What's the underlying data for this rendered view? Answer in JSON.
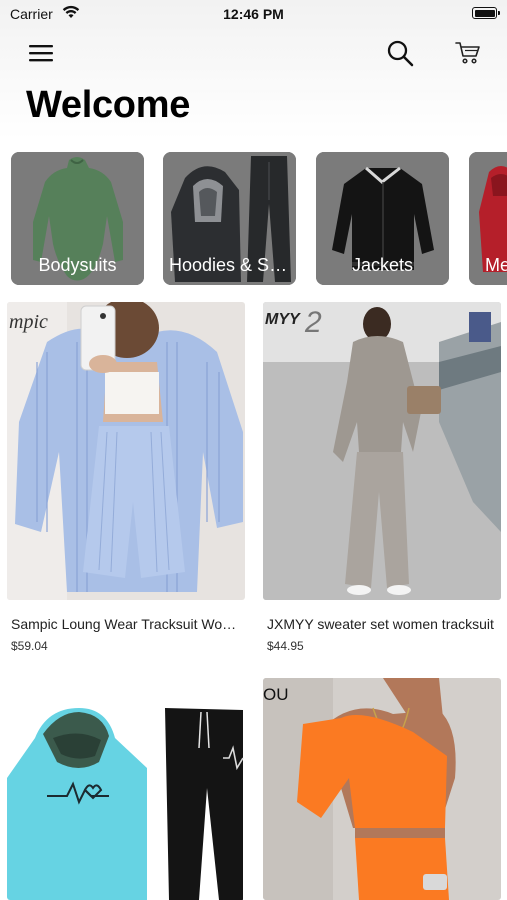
{
  "status_bar": {
    "carrier": "Carrier",
    "time": "12:46 PM"
  },
  "header": {
    "title": "Welcome"
  },
  "icons": {
    "menu": "hamburger-menu-icon",
    "search": "search-icon",
    "cart": "cart-icon"
  },
  "categories": [
    {
      "label": "Bodysuits"
    },
    {
      "label": "Hoodies & Sweatshirts"
    },
    {
      "label": "Jackets"
    },
    {
      "label": "Men"
    }
  ],
  "products": [
    {
      "name": "Sampic Loung Wear Tracksuit Women Shorts Set",
      "price": "$59.04"
    },
    {
      "name": "JXMYY sweater set women tracksuit",
      "price": "$44.95"
    },
    {
      "name": "",
      "price": ""
    },
    {
      "name": "",
      "price": ""
    }
  ]
}
